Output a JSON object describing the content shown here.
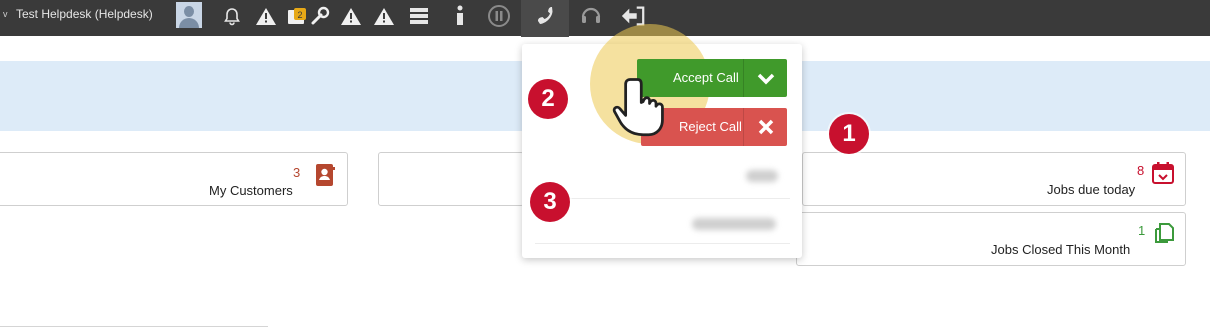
{
  "topbar": {
    "user_label": "Test Helpdesk (Helpdesk)",
    "user_caret": "v",
    "icons": [
      "bell-icon",
      "warning-icon",
      "note-badge-icon",
      "wrench-icon",
      "warning-icon",
      "warning-icon",
      "server-icon",
      "info-icon",
      "pause-icon",
      "phone-icon",
      "headset-icon",
      "logout-icon"
    ]
  },
  "cards": {
    "my_customers": {
      "count": "3",
      "label": "My Customers"
    },
    "jobs_due_today": {
      "count": "8",
      "label": "Jobs due today"
    },
    "jobs_closed_month": {
      "count": "1",
      "label": "Jobs Closed This Month"
    }
  },
  "call_menu": {
    "accept_label": "Accept Call",
    "reject_label": "Reject Call"
  },
  "annotations": {
    "step1": "1",
    "step2": "2",
    "step3": "3"
  },
  "colors": {
    "accept": "#409a2b",
    "reject": "#d9534f",
    "badge": "#c8102e",
    "topbar": "#3a3a3a",
    "band": "#ddebf8"
  }
}
